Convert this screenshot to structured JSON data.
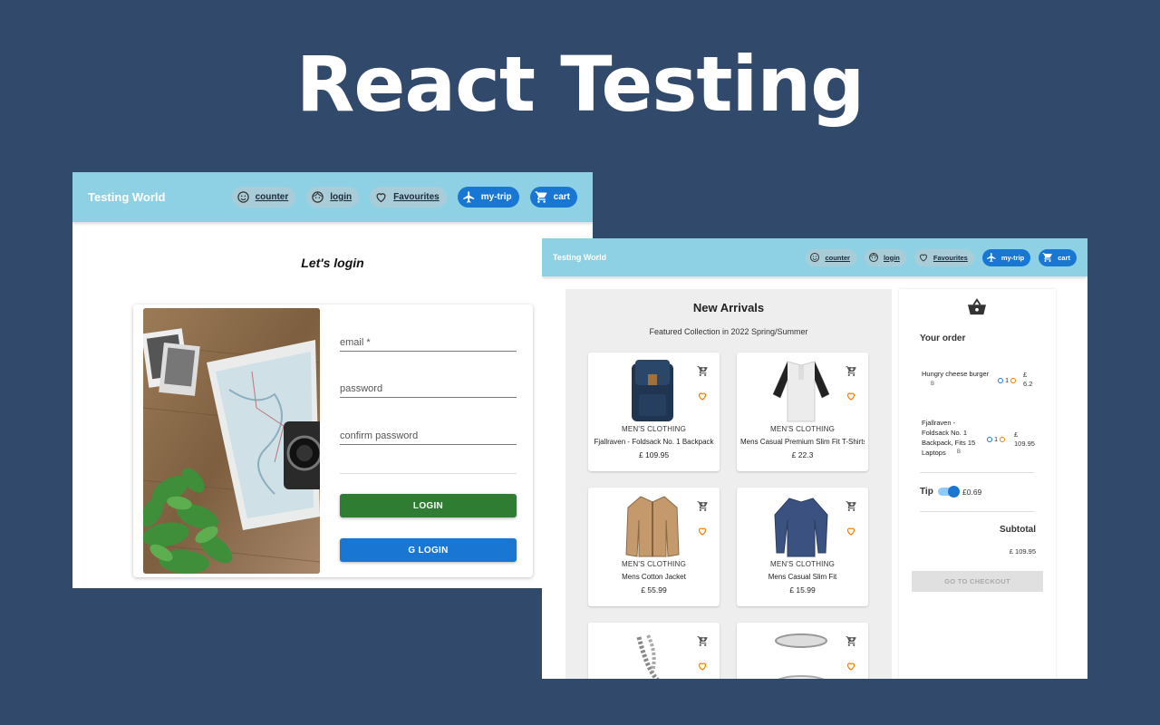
{
  "hero": {
    "title": "React Testing"
  },
  "login_window": {
    "appbar": {
      "brand": "Testing World",
      "nav": [
        {
          "label": "counter",
          "icon": "smiley-icon",
          "style": "grey"
        },
        {
          "label": "login",
          "icon": "face-icon",
          "style": "grey"
        },
        {
          "label": "Favourites",
          "icon": "heart-icon",
          "style": "grey"
        },
        {
          "label": "my-trip",
          "icon": "airplane-icon",
          "style": "blue"
        },
        {
          "label": "cart",
          "icon": "cart-icon",
          "style": "blue"
        }
      ]
    },
    "title": "Let's login",
    "form": {
      "email_placeholder": "email *",
      "password_placeholder": "password",
      "confirm_placeholder": "confirm password",
      "login_button": "LOGIN",
      "google_login_button": "G LOGIN"
    }
  },
  "shop_window": {
    "appbar": {
      "brand": "Testing World",
      "nav": [
        {
          "label": "counter",
          "icon": "smiley-icon",
          "style": "grey"
        },
        {
          "label": "login",
          "icon": "face-icon",
          "style": "grey"
        },
        {
          "label": "Favourites",
          "icon": "heart-icon",
          "style": "grey"
        },
        {
          "label": "my-trip",
          "icon": "airplane-icon",
          "style": "blue"
        },
        {
          "label": "cart",
          "icon": "cart-icon",
          "style": "blue"
        }
      ]
    },
    "products": {
      "title": "New Arrivals",
      "subtitle": "Featured Collection in 2022 Spring/Summer",
      "items": [
        {
          "category": "MEN'S CLOTHING",
          "name": "Fjallraven - Foldsack No. 1 Backpack",
          "price": "£ 109.95",
          "image": "backpack"
        },
        {
          "category": "MEN'S CLOTHING",
          "name": "Mens Casual Premium Slim Fit T-Shirts",
          "price": "£ 22.3",
          "image": "tshirt"
        },
        {
          "category": "MEN'S CLOTHING",
          "name": "Mens Cotton Jacket",
          "price": "£ 55.99",
          "image": "jacket"
        },
        {
          "category": "MEN'S CLOTHING",
          "name": "Mens Casual Slim Fit",
          "price": "£ 15.99",
          "image": "longsleeve"
        },
        {
          "category": "",
          "name": "",
          "price": "",
          "image": "bracelet"
        },
        {
          "category": "",
          "name": "",
          "price": "",
          "image": "ring"
        }
      ]
    },
    "order": {
      "title": "Your order",
      "items": [
        {
          "name": "Hungry cheese burger",
          "qty": "1",
          "price_symbol": "£",
          "price": "6.2",
          "tag": "B"
        },
        {
          "name": "Fjallraven - Foldsack No. 1 Backpack, Fits 15 Laptops",
          "qty": "1",
          "price_symbol": "£",
          "price": "109.95",
          "tag": "B"
        }
      ],
      "tip_label": "Tip",
      "tip_value": "£0.69",
      "tip_enabled": true,
      "subtotal_label": "Subtotal",
      "subtotal_value": "£ 109.95",
      "checkout_button": "GO TO CHECKOUT"
    }
  },
  "colors": {
    "background": "#31496b",
    "appbar": "#8fd1e4",
    "primary": "#1976d2",
    "login_green": "#2e7d32",
    "heart": "#f57c00"
  }
}
